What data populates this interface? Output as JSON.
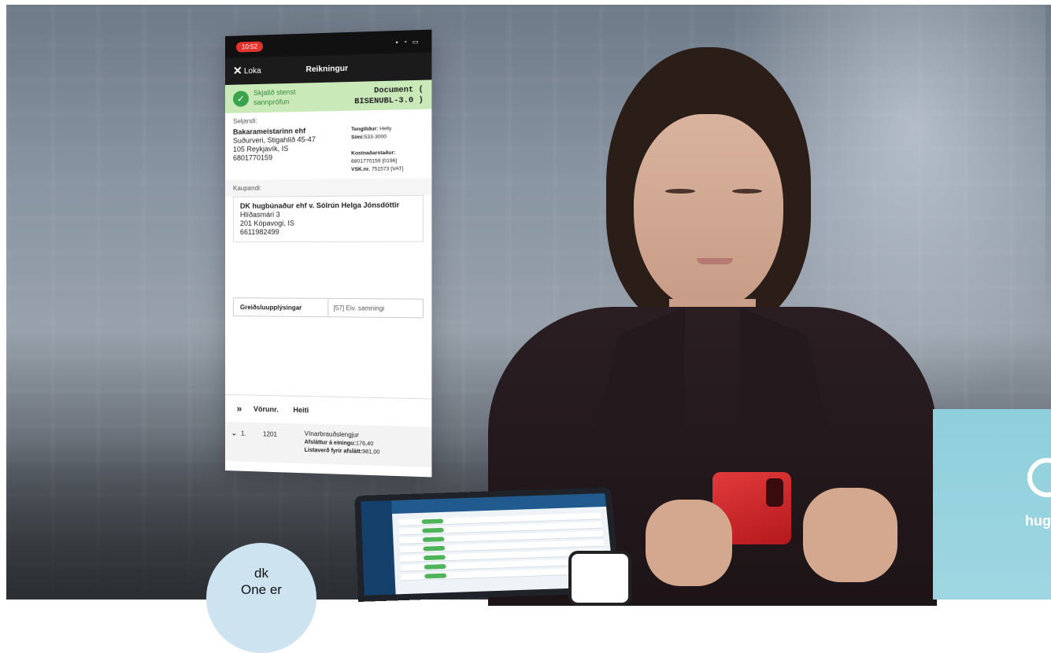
{
  "phone": {
    "status_time": "10:52",
    "close_label": "Loka",
    "nav_title": "Reikningur",
    "validation_text": "Skjalið stenst sannprófun",
    "document_type": "Document ( BISENUBL-3.0 )",
    "seller": {
      "label": "Seljandi:",
      "name": "Bakarameistarinn ehf",
      "address_1": "Suðurveri, Stigahlíð 45-47",
      "address_2": "105 Reykjavík, IS",
      "id": "6801770159",
      "contact_label": "Tengiliður:",
      "contact_value": "Helly",
      "phone_label": "Sími:",
      "phone_value": "533-3000",
      "cost_center_label": "Kostnaðarstaður:",
      "cost_center_value": "6801770159 [0196]",
      "vat_label": "VSK.nr.",
      "vat_value": "751573 [VAT]"
    },
    "buyer": {
      "label": "Kaupandi:",
      "name": "DK hugbúnaður ehf v. Sólrún Helga Jónsdóttir",
      "address_1": "Hlíðasmári 3",
      "address_2": "201 Kópavogi, IS",
      "id": "6611982499"
    },
    "payment": {
      "label": "Greiðsluupplýsingar",
      "value": "[57] Eiv. samningi"
    },
    "lines": {
      "col_number": "Vörunr.",
      "col_name": "Heiti",
      "row_index": "1.",
      "row_number": "1201",
      "row_name": "Vínarbrauðslengjur",
      "row_discount_label": "Afsláttur á einingu:",
      "row_discount_value": "176,40",
      "row_list_label": "Listaverð fyrir afslátt:",
      "row_list_value": "981,00"
    }
  },
  "badge": {
    "line1": "dk",
    "line2": "One er"
  },
  "logo": {
    "text": "hug"
  }
}
